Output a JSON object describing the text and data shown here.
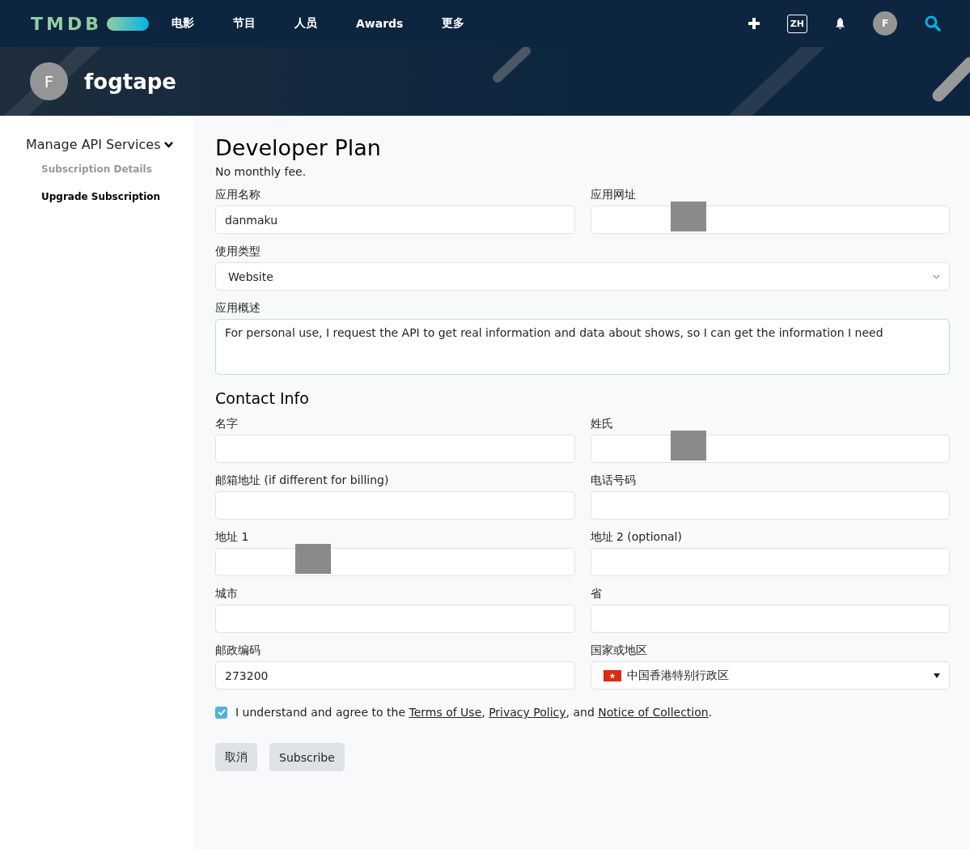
{
  "nav": {
    "logo": "TMDB",
    "items": [
      "电影",
      "节目",
      "人员",
      "Awards",
      "更多"
    ],
    "language": "ZH",
    "avatar": "F"
  },
  "profile": {
    "avatar": "F",
    "name": "fogtape"
  },
  "sidebar": {
    "title": "Manage API Services",
    "items": [
      {
        "label": "Subscription Details",
        "selected": false
      },
      {
        "label": "Upgrade Subscription",
        "selected": true
      }
    ]
  },
  "plan": {
    "title": "Developer Plan",
    "subtitle": "No monthly fee."
  },
  "app_fields": [
    {
      "kind": "pair",
      "fields": [
        {
          "label": "应用名称",
          "value": "danmaku"
        },
        {
          "label": "应用网址",
          "redacted": true
        }
      ]
    },
    {
      "kind": "select",
      "label": "使用类型",
      "value": "Website"
    },
    {
      "kind": "textarea",
      "label": "应用概述",
      "value": "For personal use, I request the API to get real information and data about shows, so I can get the information I need"
    }
  ],
  "contact": {
    "title": "Contact Info",
    "fields": [
      {
        "kind": "pair",
        "fields": [
          {
            "label": "名字",
            "redacted": false
          },
          {
            "label": "姓氏",
            "redacted": true
          }
        ]
      },
      {
        "kind": "pair",
        "fields": [
          {
            "label": "邮箱地址 (if different for billing)",
            "redacted": false
          },
          {
            "label": "电话号码",
            "redacted": false
          }
        ]
      },
      {
        "kind": "pair",
        "fields": [
          {
            "label": "地址 1",
            "redacted": true
          },
          {
            "label": "地址 2 (optional)",
            "redacted": false
          }
        ]
      },
      {
        "kind": "pair",
        "fields": [
          {
            "label": "城市",
            "redacted": false
          },
          {
            "label": "省",
            "redacted": false
          }
        ]
      },
      {
        "kind": "pair",
        "fields": [
          {
            "label": "邮政编码",
            "value": "273200"
          },
          {
            "label": "国家或地区",
            "value": "中国香港特别行政区",
            "kind": "country"
          }
        ]
      }
    ]
  },
  "agreement": {
    "checked": true,
    "parts": [
      {
        "text": "I understand and agree to the "
      },
      {
        "text": "Terms of Use",
        "link": true
      },
      {
        "text": ", "
      },
      {
        "text": "Privacy Policy",
        "link": true
      },
      {
        "text": ", and "
      },
      {
        "text": "Notice of Collection",
        "link": true
      },
      {
        "text": "."
      }
    ]
  },
  "buttons": [
    "取消",
    "Subscribe"
  ]
}
